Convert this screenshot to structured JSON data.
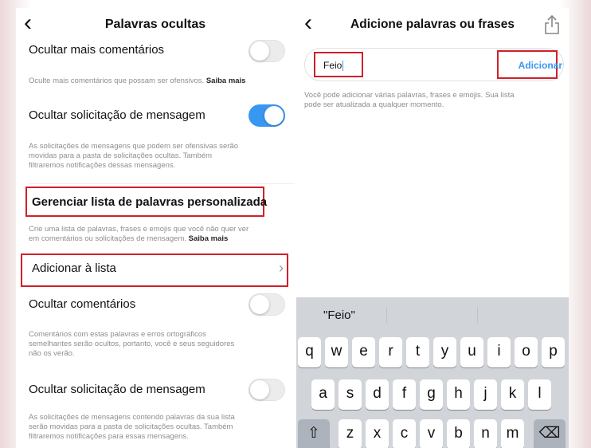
{
  "left_screen": {
    "title": "Palavras ocultas",
    "hide_more_comments": {
      "label": "Ocultar mais comentários",
      "description": "Oculte mais comentários que possam ser ofensivos.",
      "link": "Saiba mais",
      "enabled": false
    },
    "hide_message_requests": {
      "label": "Ocultar solicitação de mensagem",
      "description_line1": "As solicitações de mensagens que podem ser ofensivas serão",
      "description_line2": "movidas para a pasta de solicitações ocultas. Também",
      "description_line3": "filtraremos notificações dessas mensagens.",
      "enabled": true
    },
    "custom_list": {
      "title": "Gerenciar lista de palavras personalizada",
      "description_line1": "Crie uma lista de palavras, frases e emojis que você não quer ver",
      "description_line2": "em comentários ou solicitações de mensagem.",
      "link": "Saiba mais"
    },
    "add_to_list": {
      "label": "Adicionar à lista"
    },
    "hide_comments": {
      "label": "Ocultar comentários",
      "description_line1": "Comentários com estas palavras e erros ortográficos",
      "description_line2": "semelhantes serão ocultos, portanto, você e seus seguidores",
      "description_line3": "não os verão.",
      "enabled": false
    },
    "hide_message_requests_2": {
      "label": "Ocultar solicitação de mensagem",
      "description_line1": "As solicitações de mensagens contendo palavras da sua lista",
      "description_line2": "serão movidas para a pasta de solicitações ocultas. Também",
      "description_line3": "filtraremos notificações para essas mensagens.",
      "enabled": false
    }
  },
  "right_screen": {
    "title": "Adicione palavras ou frases",
    "input_value": "Feio",
    "add_button": "Adicionar",
    "description_line1": "Você pode adicionar várias palavras, frases e emojis. Sua lista",
    "description_line2": "pode ser atualizada a qualquer momento.",
    "keyboard": {
      "suggestion": "\"Feio\"",
      "row1": [
        "q",
        "w",
        "e",
        "r",
        "t",
        "y",
        "u",
        "i",
        "o",
        "p"
      ],
      "row2": [
        "a",
        "s",
        "d",
        "f",
        "g",
        "h",
        "j",
        "k",
        "l"
      ],
      "row3": [
        "z",
        "x",
        "c",
        "v",
        "b",
        "n",
        "m"
      ],
      "shift_glyph": "⇧",
      "delete_glyph": "⌫"
    }
  },
  "colors": {
    "highlight_box": "#d0202a",
    "toggle_on": "#3897f0",
    "link_blue": "#3897f0"
  }
}
